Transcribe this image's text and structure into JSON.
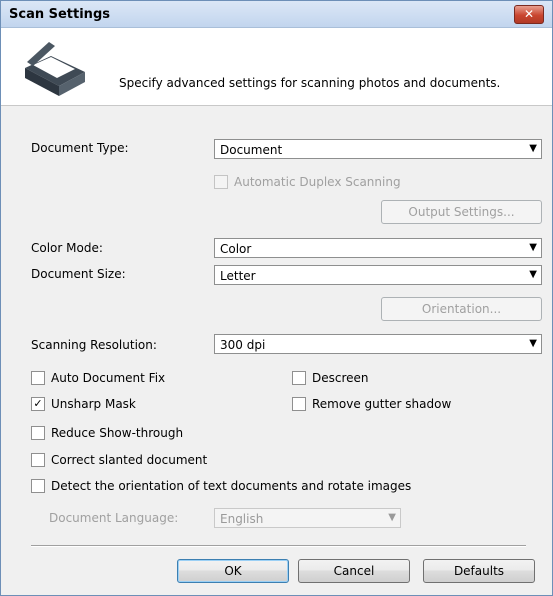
{
  "window": {
    "title": "Scan Settings",
    "close_label": "✕"
  },
  "header": {
    "description": "Specify advanced settings for scanning photos and documents."
  },
  "document_type": {
    "label": "Document Type:",
    "value": "Document"
  },
  "duplex": {
    "label": "Automatic Duplex Scanning",
    "checked": false,
    "enabled": false
  },
  "output_settings": {
    "label": "Output Settings..."
  },
  "color_mode": {
    "label": "Color Mode:",
    "value": "Color"
  },
  "document_size": {
    "label": "Document Size:",
    "value": "Letter"
  },
  "orientation": {
    "label": "Orientation..."
  },
  "resolution": {
    "label": "Scanning Resolution:",
    "value": "300 dpi"
  },
  "checkboxes": {
    "auto_fix": {
      "label": "Auto Document Fix",
      "checked": false
    },
    "descreen": {
      "label": "Descreen",
      "checked": false
    },
    "unsharp": {
      "label": "Unsharp Mask",
      "checked": true
    },
    "gutter": {
      "label": "Remove gutter shadow",
      "checked": false
    },
    "show_through": {
      "label": "Reduce Show-through",
      "checked": false
    },
    "slanted": {
      "label": "Correct slanted document",
      "checked": false
    },
    "detect_orientation": {
      "label": "Detect the orientation of text documents and rotate images",
      "checked": false
    }
  },
  "document_language": {
    "label": "Document Language:",
    "value": "English"
  },
  "footer": {
    "ok": "OK",
    "cancel": "Cancel",
    "defaults": "Defaults"
  },
  "icons": {
    "check_mark": "✓",
    "dropdown_arrow": "▼"
  }
}
